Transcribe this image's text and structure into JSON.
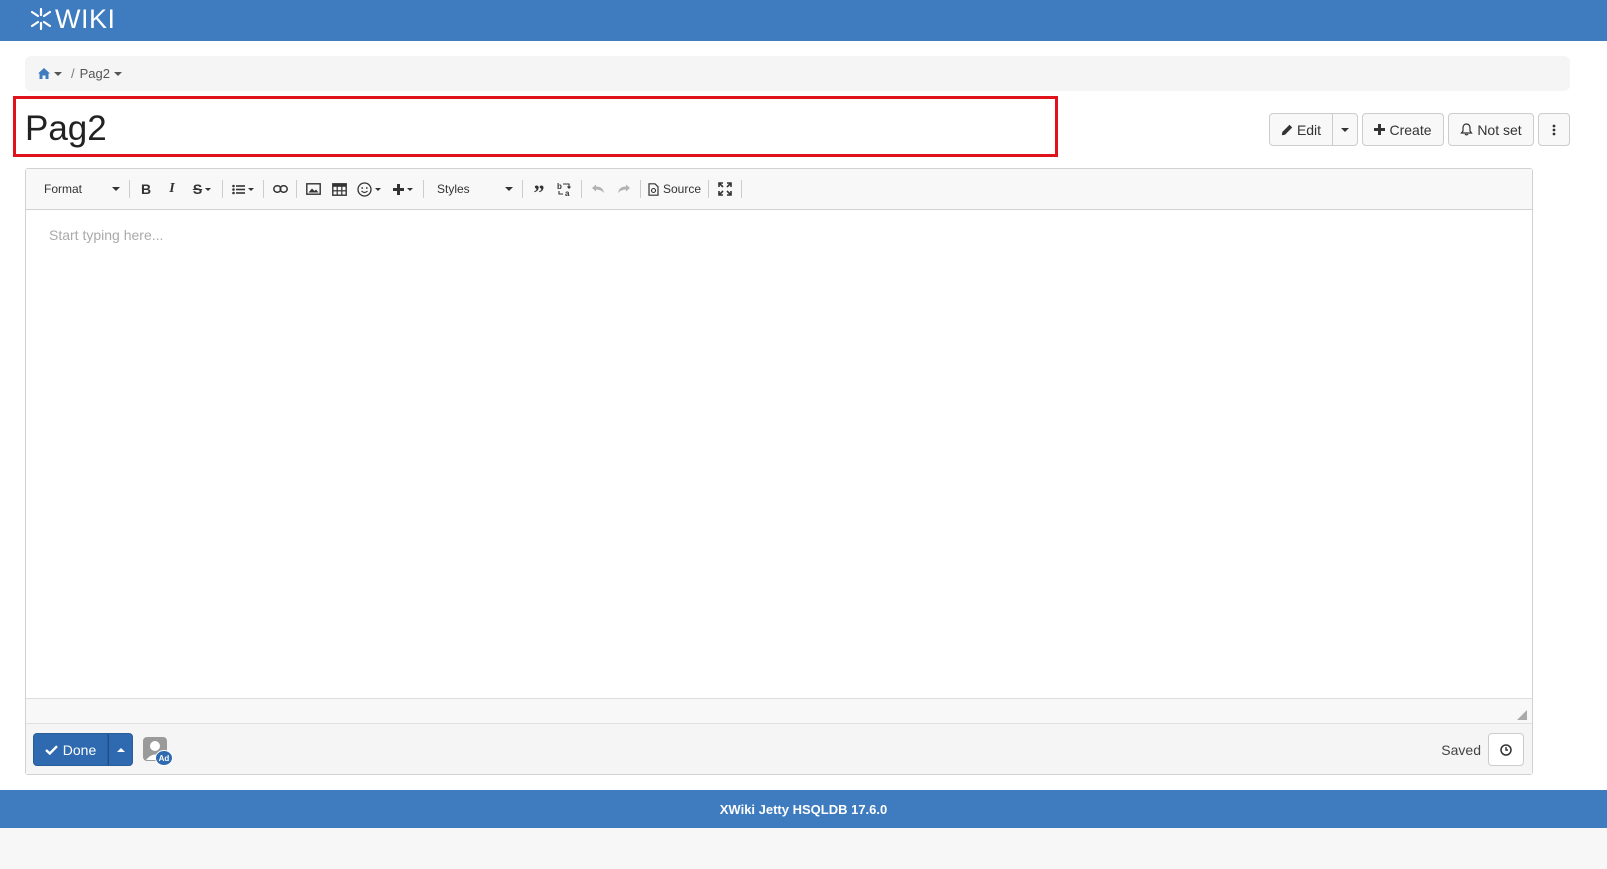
{
  "header": {
    "logo_text": "WIKI",
    "logo_icon": "xwiki-asterisk-icon",
    "color": "#3e7bbf"
  },
  "breadcrumb": {
    "home_icon": "home-icon",
    "separator": "/",
    "current": "Pag2"
  },
  "page": {
    "title": "Pag2"
  },
  "actions": {
    "edit": "Edit",
    "create": "Create",
    "notifications": "Not set"
  },
  "toolbar": {
    "format": "Format",
    "styles": "Styles",
    "source": "Source",
    "buttons": [
      "bold",
      "italic",
      "strikethrough",
      "list",
      "link",
      "image",
      "table",
      "emoji",
      "insert",
      "blockquote",
      "find-replace",
      "undo",
      "redo",
      "source",
      "maximize"
    ]
  },
  "editor": {
    "placeholder": "Start typing here..."
  },
  "bottom": {
    "done": "Done",
    "avatar_badge": "Ad",
    "status": "Saved"
  },
  "footer": {
    "text": "XWiki Jetty HSQLDB 17.6.0"
  },
  "colors": {
    "accent": "#3e7bbf",
    "primary_button": "#2f6ab0",
    "highlight_border": "#e0131d"
  }
}
